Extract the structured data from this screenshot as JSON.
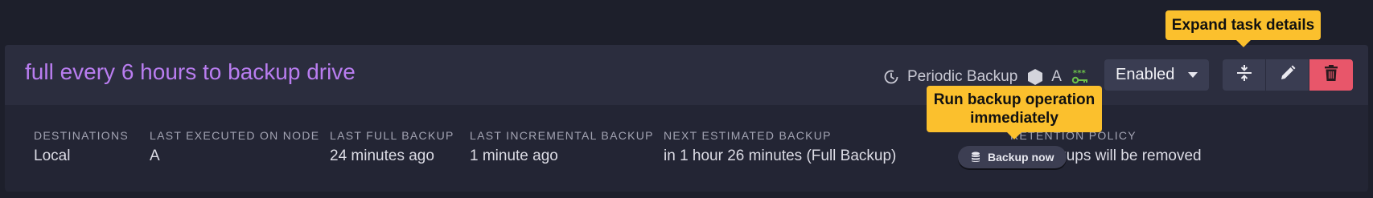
{
  "task": {
    "title": "full every 6 hours to backup drive",
    "type_label": "Periodic Backup",
    "node_tag": "A",
    "state": "Enabled"
  },
  "actions": {
    "expand_icon": "expand-vertical-icon",
    "edit_icon": "pencil-icon",
    "delete_icon": "trash-icon"
  },
  "details": {
    "destinations": {
      "label": "DESTINATIONS",
      "value": "Local"
    },
    "last_executed": {
      "label": "LAST EXECUTED ON NODE",
      "value": "A"
    },
    "last_full": {
      "label": "LAST FULL BACKUP",
      "value": "24 minutes ago"
    },
    "last_incremental": {
      "label": "LAST INCREMENTAL BACKUP",
      "value": "1 minute ago"
    },
    "next_estimated": {
      "label": "NEXT ESTIMATED BACKUP",
      "value": "in 1 hour 26 minutes (Full Backup)"
    },
    "retention": {
      "label": "RETENTION POLICY",
      "value": "No backups will be removed"
    }
  },
  "backup_now": {
    "label": "Backup now"
  },
  "tooltips": {
    "expand": "Expand task details",
    "run_backup": "Run backup operation immediately"
  },
  "colors": {
    "background": "#1d1f2b",
    "card": "#232534",
    "header": "#2b2d3e",
    "title": "#b97df0",
    "danger": "#e8566a",
    "tooltip": "#fbc02d",
    "key_icon": "#6cc24a"
  }
}
